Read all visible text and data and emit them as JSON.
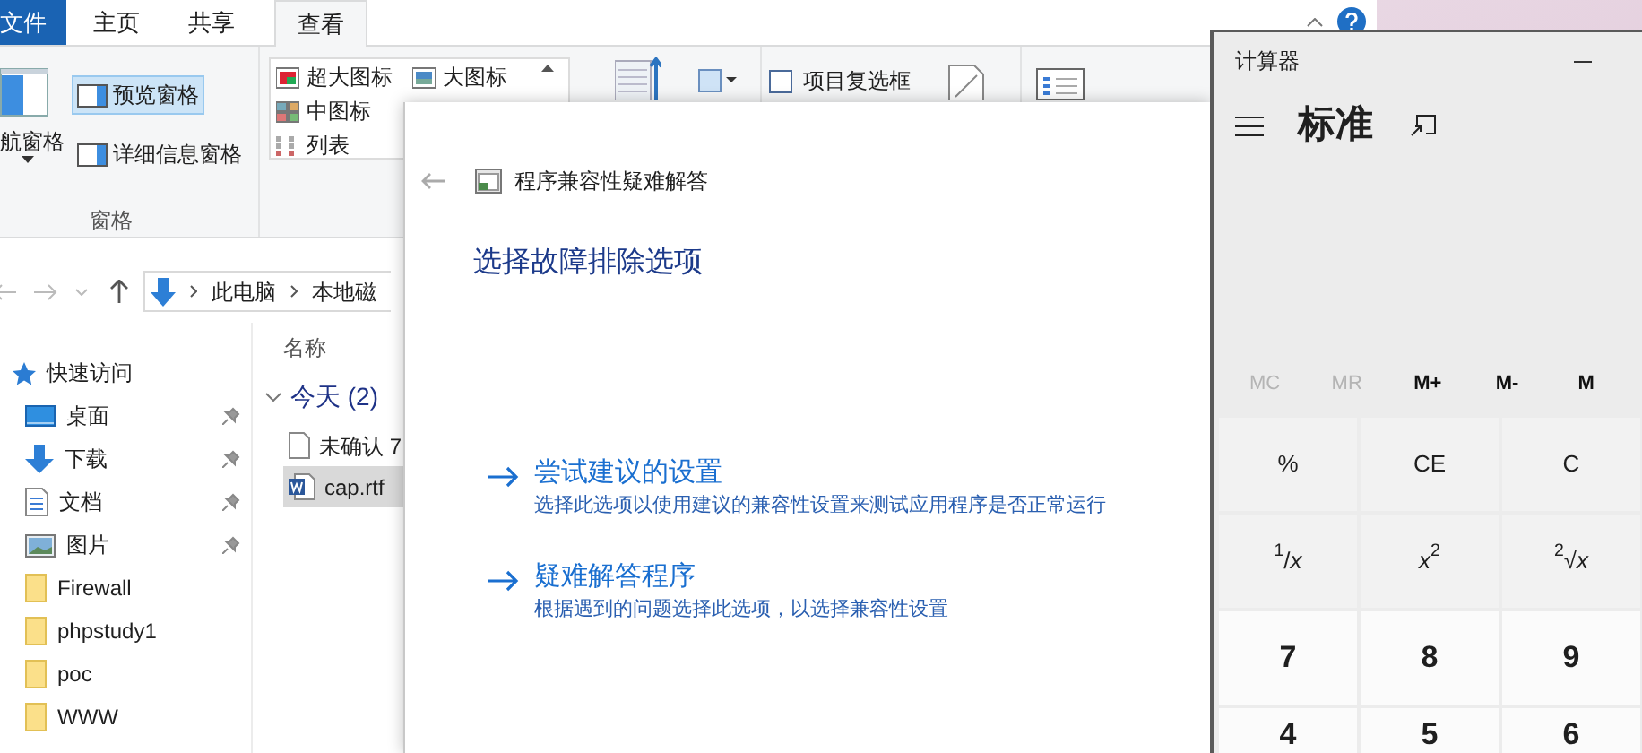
{
  "explorer": {
    "ribbon_tabs": [
      {
        "label": "文件",
        "kind": "file",
        "selected": false
      },
      {
        "label": "主页",
        "kind": "tab",
        "selected": false
      },
      {
        "label": "共享",
        "kind": "tab",
        "selected": false
      },
      {
        "label": "查看",
        "kind": "tab",
        "selected": true
      }
    ],
    "ribbon": {
      "panes_group": {
        "label": "窗格",
        "navigation_pane": "航窗格",
        "preview_pane": {
          "label": "预览窗格",
          "selected": true
        },
        "details_pane": {
          "label": "详细信息窗格",
          "selected": false
        }
      },
      "layout_options": [
        [
          "超大图标",
          "大图标"
        ],
        [
          "中图标"
        ],
        [
          "列表"
        ]
      ],
      "item_checkboxes": {
        "label": "项目复选框",
        "checked": false
      }
    },
    "address": {
      "crumbs": [
        "此电脑",
        "本地磁"
      ]
    },
    "nav_pane": [
      {
        "label": "快速访问",
        "kind": "star",
        "pinned": false
      },
      {
        "label": "桌面",
        "kind": "desktop",
        "pinned": true
      },
      {
        "label": "下载",
        "kind": "download",
        "pinned": true
      },
      {
        "label": "文档",
        "kind": "document",
        "pinned": true
      },
      {
        "label": "图片",
        "kind": "pictures",
        "pinned": true
      },
      {
        "label": "Firewall",
        "kind": "folder",
        "pinned": false
      },
      {
        "label": "phpstudy1",
        "kind": "folder",
        "pinned": false
      },
      {
        "label": "poc",
        "kind": "folder",
        "pinned": false
      },
      {
        "label": "WWW",
        "kind": "folder",
        "pinned": false
      }
    ],
    "file_list": {
      "column": "名称",
      "group": "今天 (2)",
      "files": [
        {
          "name": "未确认 7",
          "kind": "document",
          "selected": false
        },
        {
          "name": "cap.rtf",
          "kind": "word",
          "selected": true
        }
      ]
    }
  },
  "troubleshooter": {
    "title": "程序兼容性疑难解答",
    "heading": "选择故障排除选项",
    "options": [
      {
        "title": "尝试建议的设置",
        "description": "选择此选项以使用建议的兼容性设置来测试应用程序是否正常运行"
      },
      {
        "title": "疑难解答程序",
        "description": "根据遇到的问题选择此选项，以选择兼容性设置"
      }
    ]
  },
  "calculator": {
    "title": "计算器",
    "mode": "标准",
    "memory_buttons": [
      {
        "label": "MC",
        "disabled": true
      },
      {
        "label": "MR",
        "disabled": true
      },
      {
        "label": "M+",
        "disabled": false
      },
      {
        "label": "M-",
        "disabled": false
      },
      {
        "label": "M",
        "disabled": false
      }
    ],
    "keys": [
      {
        "label": "%",
        "kind": "function"
      },
      {
        "label": "CE",
        "kind": "function"
      },
      {
        "label": "C",
        "kind": "function"
      },
      {
        "label": "$^{1}$/*x*",
        "kind": "function"
      },
      {
        "label": "*x*$^{2}$",
        "kind": "function"
      },
      {
        "label": "$^{2}$√*x*",
        "kind": "function"
      },
      {
        "label": "7",
        "kind": "digit"
      },
      {
        "label": "8",
        "kind": "digit"
      },
      {
        "label": "9",
        "kind": "digit"
      },
      {
        "label": "4",
        "kind": "digit"
      },
      {
        "label": "5",
        "kind": "digit"
      },
      {
        "label": "6",
        "kind": "digit"
      }
    ]
  }
}
